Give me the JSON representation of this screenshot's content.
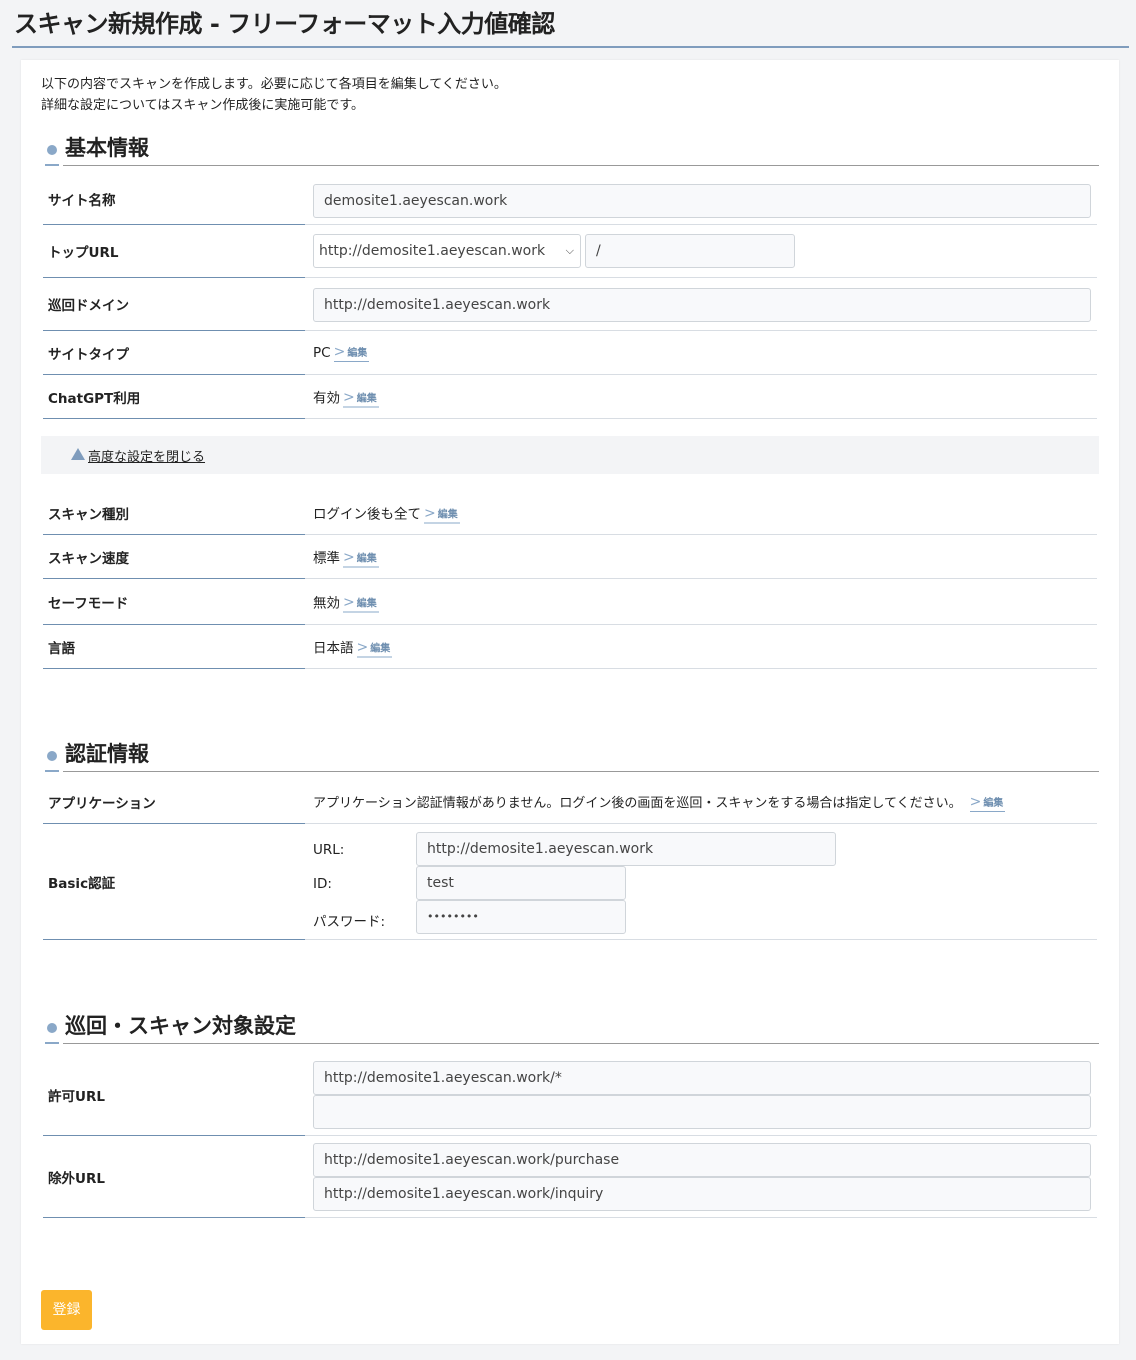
{
  "page_title": "スキャン新規作成 - フリーフォーマット入力値確認",
  "intro": {
    "line1": "以下の内容でスキャンを作成します。必要に応じて各項目を編集してください。",
    "line2": "詳細な設定についてはスキャン作成後に実施可能です。"
  },
  "edit_label": "編集",
  "basic": {
    "heading": "基本情報",
    "site_name": {
      "label": "サイト名称",
      "value": "demosite1.aeyescan.work"
    },
    "top_url": {
      "label": "トップURL",
      "select_value": "http://demosite1.aeyescan.work",
      "path_value": "/"
    },
    "domain": {
      "label": "巡回ドメイン",
      "value": "http://demosite1.aeyescan.work"
    },
    "site_type": {
      "label": "サイトタイプ",
      "value": "PC"
    },
    "chatgpt": {
      "label": "ChatGPT利用",
      "value": "有効"
    }
  },
  "advanced_toggle": "高度な設定を閉じる",
  "advanced": {
    "scan_type": {
      "label": "スキャン種別",
      "value": "ログイン後も全て"
    },
    "scan_speed": {
      "label": "スキャン速度",
      "value": "標準"
    },
    "safe_mode": {
      "label": "セーフモード",
      "value": "無効"
    },
    "language": {
      "label": "言語",
      "value": "日本語"
    }
  },
  "auth": {
    "heading": "認証情報",
    "application": {
      "label": "アプリケーション",
      "value": "アプリケーション認証情報がありません。ログイン後の画面を巡回・スキャンをする場合は指定してください。"
    },
    "basic_auth": {
      "label": "Basic認証",
      "url_label": "URL:",
      "url_value": "http://demosite1.aeyescan.work",
      "id_label": "ID:",
      "id_value": "test",
      "password_label": "パスワード:",
      "password_value": "••••••••"
    }
  },
  "target": {
    "heading": "巡回・スキャン対象設定",
    "allow": {
      "label": "許可URL",
      "values": [
        "http://demosite1.aeyescan.work/*",
        ""
      ]
    },
    "exclude": {
      "label": "除外URL",
      "values": [
        "http://demosite1.aeyescan.work/purchase",
        "http://demosite1.aeyescan.work/inquiry"
      ]
    }
  },
  "submit_label": "登録",
  "colors": {
    "accent": "#7f9cbd",
    "button": "#fbb52c"
  }
}
